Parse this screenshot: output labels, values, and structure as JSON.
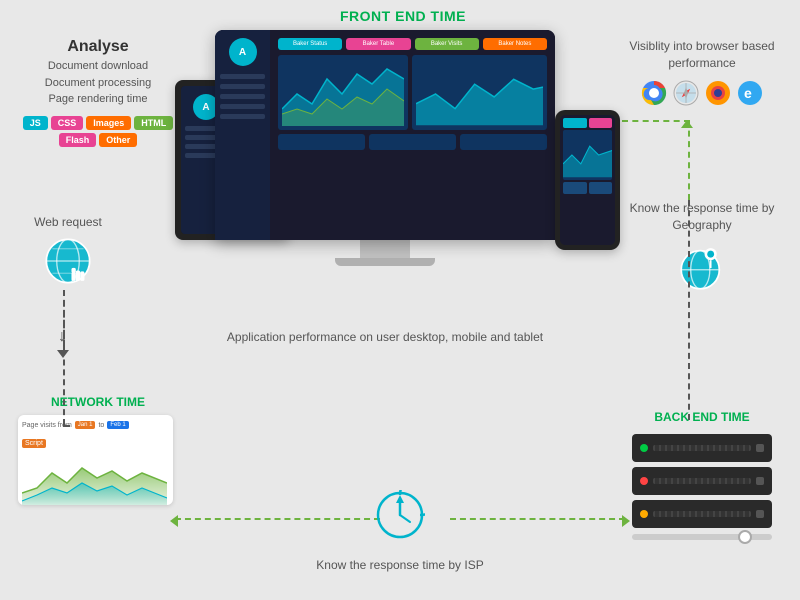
{
  "title": {
    "front_end": "FRONT END TIME",
    "network_time": "NETWORK TIME",
    "back_end_time": "BACK END TIME"
  },
  "analyse": {
    "heading": "Analyse",
    "lines": [
      "Document download",
      "Document processing",
      "Page rendering time"
    ],
    "chips": [
      {
        "label": "JS",
        "color": "#00b4cc"
      },
      {
        "label": "CSS",
        "color": "#e84393"
      },
      {
        "label": "Images",
        "color": "#ff6d00"
      },
      {
        "label": "HTML",
        "color": "#6db33f"
      },
      {
        "label": "Flash",
        "color": "#e84393"
      },
      {
        "label": "Other",
        "color": "#ff6d00"
      }
    ]
  },
  "visibility": {
    "text": "Visiblity into browser based performance",
    "browsers": [
      "C",
      "S",
      "F",
      "E"
    ]
  },
  "web_request": {
    "label": "Web request"
  },
  "geography": {
    "label": "Know the response time by Geography"
  },
  "caption": {
    "text": "Application performance on user desktop, mobile and tablet"
  },
  "isp": {
    "text": "Know the response time by ISP"
  },
  "servers": [
    {
      "led_color": "#00cc44"
    },
    {
      "led_color": "#ff4444"
    },
    {
      "led_color": "#ffaa00"
    }
  ],
  "arrows": {
    "left_label": "←",
    "right_label": "→"
  }
}
